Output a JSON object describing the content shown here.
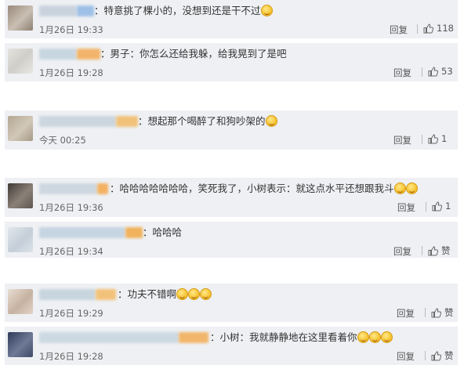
{
  "comments": [
    {
      "text": "：特意挑了棵小的，没想到还是干不过",
      "emojis": 1,
      "time": "1月26日 19:33",
      "reply": "回复",
      "likes": "118",
      "colors": {
        "avatar": "#b7a99a",
        "name": "#c9d3de",
        "tag": "#9fc0e6"
      }
    },
    {
      "text": "：男子：你怎么还给我躲，给我晃到了是吧",
      "emojis": 0,
      "time": "1月26日 19:28",
      "reply": "回复",
      "likes": "53",
      "colors": {
        "avatar": "#d9d8d2",
        "name": "#c8d6e0",
        "tag": "#f2b46a"
      }
    },
    {
      "text": "：想起那个喝醉了和狗吵架的",
      "emojis": 1,
      "time": "今天 00:25",
      "reply": "回复",
      "likes": "1",
      "colors": {
        "avatar": "#c4b8a4",
        "name": "#cbd6df",
        "tag": "#f0c27a"
      }
    },
    {
      "text": "：哈哈哈哈哈哈哈，笑死我了，小树表示：就这点水平还想跟我斗",
      "emojis": 2,
      "time": "1月26日 19:36",
      "reply": "回复",
      "likes": "1",
      "colors": {
        "avatar": "#6d6660",
        "name": "#cdd7e0",
        "tag": "#f4b161"
      }
    },
    {
      "text": "：哈哈哈",
      "emojis": 0,
      "time": "1月26日 19:34",
      "reply": "回复",
      "likes": "赞",
      "colors": {
        "avatar": "#cfd6dd",
        "name": "#c6d5e2",
        "tag": "#f0b25c"
      }
    },
    {
      "text": "：功夫不错啊",
      "emojis": 3,
      "time": "1月26日 19:29",
      "reply": "回复",
      "likes": "赞",
      "colors": {
        "avatar": "#d6c7b8",
        "name": "#c8d5de",
        "tag": "#f3c27a"
      }
    },
    {
      "text": "：小树：我就静静地在这里看着你",
      "emojis": 3,
      "time": "1月26日 19:28",
      "reply": "回复",
      "likes": "赞",
      "colors": {
        "avatar": "#4e5a72",
        "name": "#ccd9e3",
        "tag": "#f2b66a"
      }
    }
  ]
}
